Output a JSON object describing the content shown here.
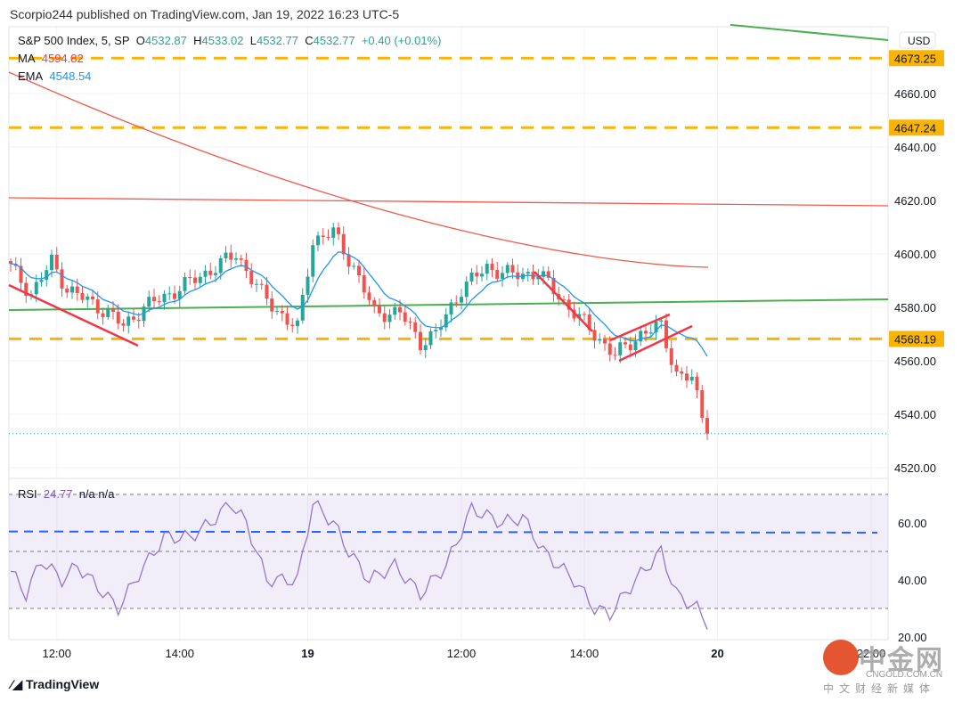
{
  "header": {
    "published": "Scorpio244 published on TradingView.com, Jan 19, 2022 16:23 UTC-5",
    "symbol": "S&P 500 Index, 5, SP",
    "o_label": "O",
    "o": "4532.87",
    "h_label": "H",
    "h": "4533.02",
    "l_label": "L",
    "l": "4532.77",
    "c_label": "C",
    "c": "4532.77",
    "change": "+0.40 (+0.01%)",
    "ma_label": "MA",
    "ma": "4594.82",
    "ema_label": "EMA",
    "ema": "4548.54",
    "rsi_label": "RSI",
    "rsi": "24.77",
    "rsi_extra": "n/a  n/a"
  },
  "footer": {
    "logo": "TradingView",
    "watermark": "中金网",
    "watermark_url": "CNGOLD.COM.CN",
    "watermark_sub": "中文财经新媒体"
  },
  "chart_data": {
    "type": "candlestick",
    "currency": "USD",
    "ylim": [
      4513,
      4690
    ],
    "yticks": [
      "4660.00",
      "4640.00",
      "4620.00",
      "4600.00",
      "4580.00",
      "4560.00",
      "4540.00",
      "4520.00"
    ],
    "ytick_values": [
      4660,
      4640,
      4620,
      4600,
      4580,
      4560,
      4540,
      4520
    ],
    "xticks": [
      "12:00",
      "14:00",
      "19",
      "12:00",
      "14:00",
      "20",
      "22:00"
    ],
    "xtick_bars": [
      9,
      33,
      58,
      88,
      112,
      138,
      168
    ],
    "price_path": [
      [
        0,
        4595
      ],
      [
        4,
        4585
      ],
      [
        8,
        4597
      ],
      [
        11,
        4587
      ],
      [
        19,
        4578
      ],
      [
        22,
        4573
      ],
      [
        26,
        4580
      ],
      [
        31,
        4585
      ],
      [
        40,
        4595
      ],
      [
        44,
        4600
      ],
      [
        49,
        4585
      ],
      [
        54,
        4575
      ],
      [
        56,
        4572
      ],
      [
        59,
        4605
      ],
      [
        63,
        4608
      ],
      [
        67,
        4595
      ],
      [
        71,
        4578
      ],
      [
        76,
        4578
      ],
      [
        80,
        4567
      ],
      [
        83,
        4570
      ],
      [
        88,
        4587
      ],
      [
        93,
        4595
      ],
      [
        98,
        4592
      ],
      [
        103,
        4593
      ],
      [
        108,
        4582
      ],
      [
        113,
        4572
      ],
      [
        118,
        4562
      ],
      [
        123,
        4570
      ],
      [
        127,
        4573
      ],
      [
        130,
        4555
      ],
      [
        133,
        4553
      ],
      [
        136,
        4533
      ]
    ],
    "horizontal_levels": [
      {
        "price": 4673.25,
        "label": "4673.25",
        "color": "#f9b507"
      },
      {
        "price": 4647.24,
        "label": "4647.24",
        "color": "#f9b507"
      },
      {
        "price": 4568.19,
        "label": "4568.19",
        "color": "#f9b507"
      }
    ],
    "last_price": 4532.77,
    "ma_start": 4668,
    "ma_end": 4595,
    "red_line": [
      4621,
      4618
    ],
    "green_line": [
      4579,
      4583
    ],
    "green_top": [
      4685.7,
      4680
    ],
    "colors": {
      "up": "#26a69a",
      "down": "#ef5350",
      "ma": "#f05a4a",
      "ema": "#2196f3",
      "green": "#4caf50",
      "rsi": "#9575cd"
    },
    "rsi": {
      "ylim": [
        17,
        73
      ],
      "yticks": [
        "60.00",
        "40.00",
        "20.00"
      ],
      "ytick_values": [
        60,
        40,
        20
      ],
      "bands": [
        70,
        50,
        30
      ],
      "level_line": 57,
      "path": [
        [
          0,
          43
        ],
        [
          3,
          35
        ],
        [
          6,
          47
        ],
        [
          10,
          40
        ],
        [
          13,
          45
        ],
        [
          21,
          30
        ],
        [
          25,
          42
        ],
        [
          30,
          55
        ],
        [
          35,
          55
        ],
        [
          39,
          60
        ],
        [
          43,
          67
        ],
        [
          46,
          60
        ],
        [
          50,
          40
        ],
        [
          56,
          40
        ],
        [
          59,
          67
        ],
        [
          63,
          60
        ],
        [
          66,
          50
        ],
        [
          70,
          40
        ],
        [
          75,
          45
        ],
        [
          80,
          35
        ],
        [
          85,
          45
        ],
        [
          90,
          65
        ],
        [
          96,
          60
        ],
        [
          100,
          62
        ],
        [
          104,
          50
        ],
        [
          110,
          40
        ],
        [
          114,
          30
        ],
        [
          117,
          28
        ],
        [
          122,
          40
        ],
        [
          127,
          50
        ],
        [
          130,
          35
        ],
        [
          134,
          30
        ],
        [
          136,
          25
        ]
      ]
    }
  }
}
